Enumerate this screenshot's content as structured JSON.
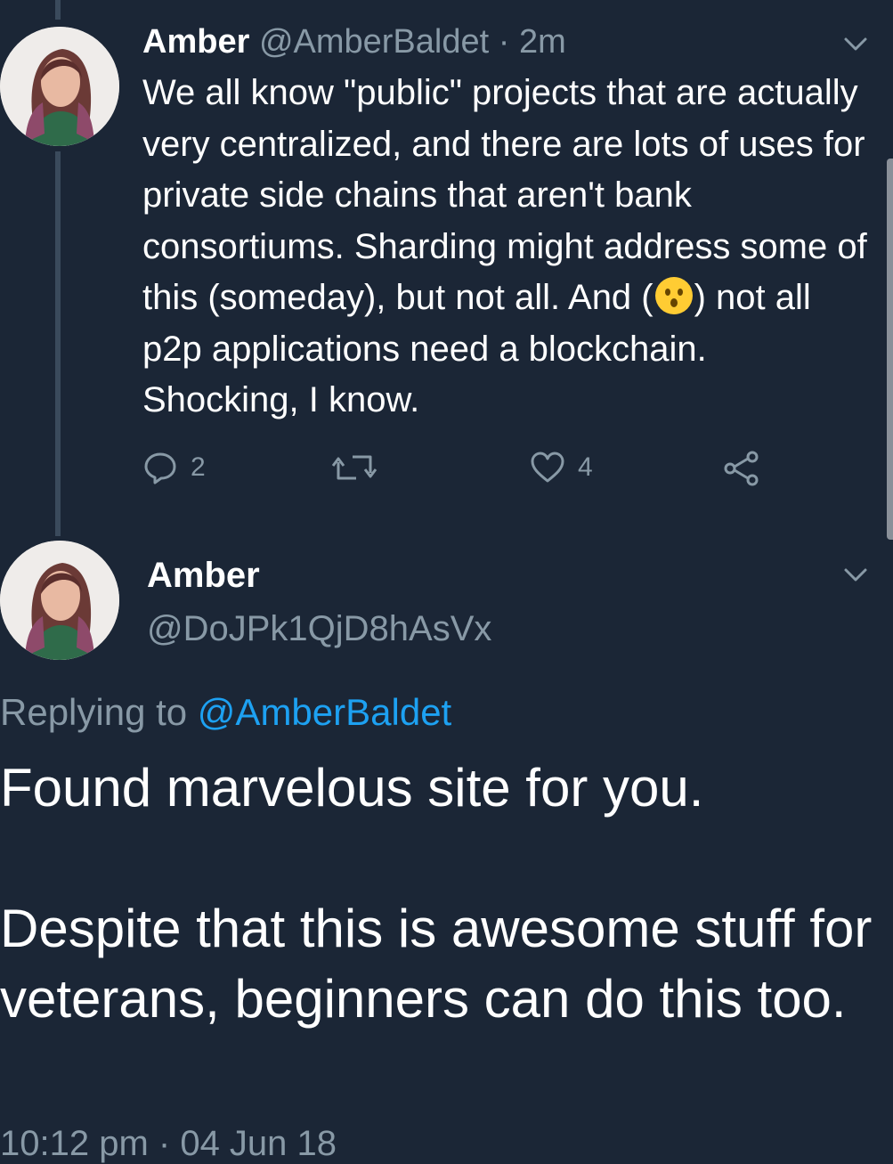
{
  "tweet": {
    "name": "Amber",
    "handle": "@AmberBaldet",
    "time": "· 2m",
    "text_before_emoji": "We all know \"public\" projects that are actually very centralized, and there are lots of uses for private side chains that aren't bank consortiums. Sharding might address some of this (someday), but not all. And (",
    "emoji": "hushed-face",
    "text_after_emoji": ") not all p2p applications need a blockchain. Shocking, I know.",
    "actions": {
      "reply_count": "2",
      "retweet_count": "",
      "like_count": "4"
    }
  },
  "reply": {
    "name": "Amber",
    "handle": "@DoJPk1QjD8hAsVx",
    "replying_prefix": "Replying to ",
    "replying_to": "@AmberBaldet",
    "paragraph1": "Found marvelous site for you.",
    "paragraph2": "Despite that this is awesome stuff for veterans, beginners can do this too.",
    "timestamp": "10:12 pm · 04 Jun 18"
  },
  "colors": {
    "background": "#1b2636",
    "muted": "#8899a6",
    "link": "#1da1f2",
    "thread_line": "#3a4a5c"
  },
  "icons": [
    "chevron-down-icon",
    "reply-icon",
    "retweet-icon",
    "like-icon",
    "share-icon",
    "avatar"
  ]
}
